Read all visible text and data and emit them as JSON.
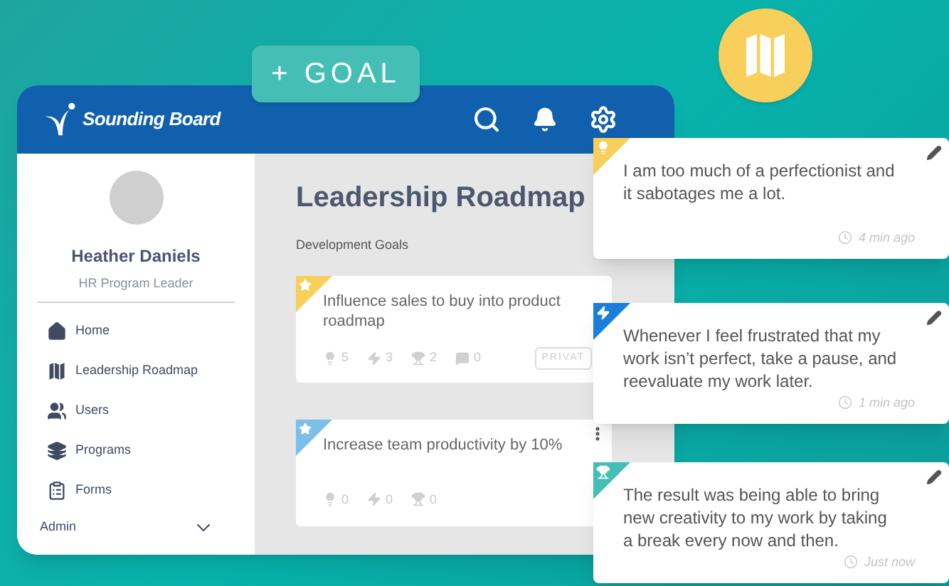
{
  "add_button": {
    "label": "+ GOAL"
  },
  "app": {
    "brand": "Sounding Board",
    "profile": {
      "name": "Heather Daniels",
      "role": "HR Program Leader"
    },
    "nav": [
      {
        "kind": "home",
        "label": "Home"
      },
      {
        "kind": "roadmap",
        "label": "Leadership Roadmap"
      },
      {
        "kind": "users",
        "label": "Users"
      },
      {
        "kind": "programs",
        "label": "Programs"
      },
      {
        "kind": "forms",
        "label": "Forms"
      }
    ],
    "admin": {
      "label": "Admin"
    },
    "page_title": "Leadership Roadmap",
    "section_title": "Development Goals",
    "goals": [
      {
        "title": "Influence sales to buy into product roadmap",
        "color": "#f7cf5a",
        "stats": [
          {
            "kind": "idea",
            "count": "5"
          },
          {
            "kind": "action",
            "count": "3"
          },
          {
            "kind": "result",
            "count": "2"
          },
          {
            "kind": "comment",
            "count": "0"
          }
        ],
        "badge": "PRIVAT",
        "menu": false
      },
      {
        "title": "Increase team productivity by 10%",
        "color": "#7cc0ea",
        "stats": [
          {
            "kind": "idea",
            "count": "0"
          },
          {
            "kind": "action",
            "count": "0"
          },
          {
            "kind": "result",
            "count": "0"
          }
        ],
        "menu": true
      }
    ]
  },
  "notes": [
    {
      "kind": "idea",
      "text": "I am too much of a perfectionist and it sabotages me a lot.",
      "time": "4 min ago"
    },
    {
      "kind": "action",
      "text": "Whenever I feel frustrated that my work isn’t perfect, take a pause, and reevaluate my work later.",
      "time": "1 min ago"
    },
    {
      "kind": "result",
      "text": "The result was being able to bring new creativity to my work by taking a break every now and then.",
      "time": "Just now"
    }
  ]
}
